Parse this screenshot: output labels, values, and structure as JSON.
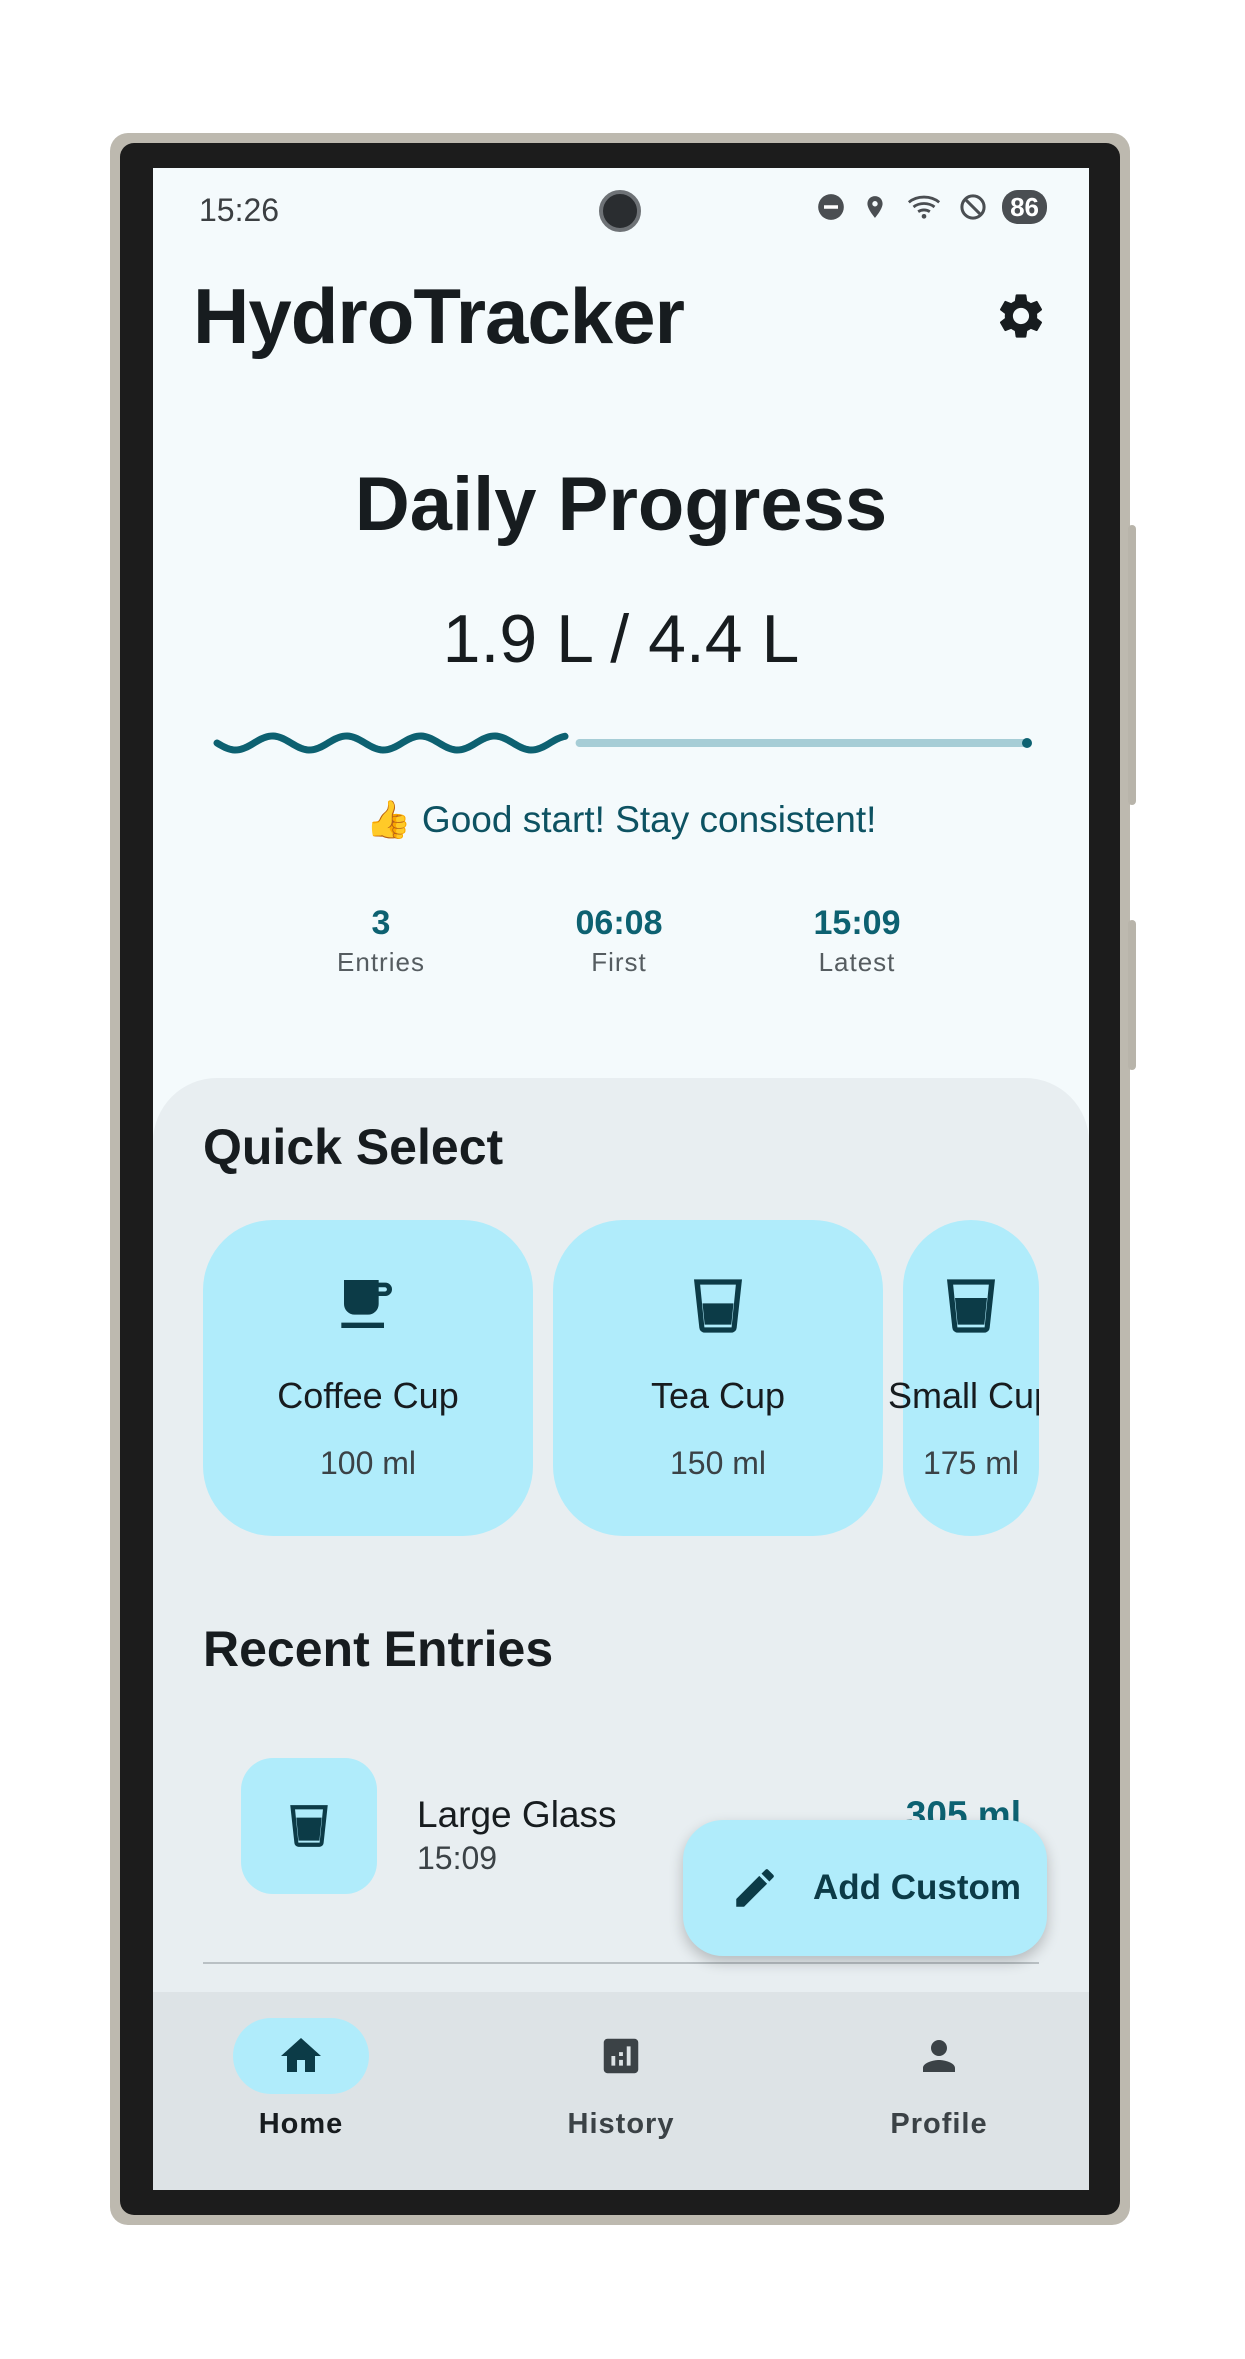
{
  "status_bar": {
    "time": "15:26",
    "battery": "86",
    "icons": [
      "do-not-disturb-icon",
      "location-icon",
      "wifi-icon",
      "blocked-icon"
    ]
  },
  "app_bar": {
    "title": "HydroTracker",
    "settings_icon": "gear-icon"
  },
  "progress": {
    "title": "Daily Progress",
    "amount_text": "1.9 L / 4.4 L",
    "fraction": 0.43,
    "message": "👍 Good start! Stay consistent!",
    "stats": [
      {
        "value": "3",
        "label": "Entries"
      },
      {
        "value": "06:08",
        "label": "First"
      },
      {
        "value": "15:09",
        "label": "Latest"
      }
    ]
  },
  "quick_select": {
    "title": "Quick Select",
    "items": [
      {
        "name": "Coffee Cup",
        "volume": "100 ml",
        "icon": "coffee-cup-icon"
      },
      {
        "name": "Tea Cup",
        "volume": "150 ml",
        "icon": "glass-icon"
      },
      {
        "name": "Small Cup",
        "volume": "175 ml",
        "icon": "glass-icon"
      }
    ]
  },
  "recent_entries": {
    "title": "Recent Entries",
    "items": [
      {
        "name": "Large Glass",
        "time": "15:09",
        "amount": "305 ml",
        "icon": "glass-icon"
      }
    ]
  },
  "fab": {
    "label": "Add Custom",
    "icon": "pencil-icon"
  },
  "bottom_nav": {
    "items": [
      {
        "label": "Home",
        "icon": "home-icon",
        "active": true
      },
      {
        "label": "History",
        "icon": "chart-icon",
        "active": false
      },
      {
        "label": "Profile",
        "icon": "person-icon",
        "active": false
      }
    ]
  },
  "colors": {
    "accent": "#0d6171",
    "card_bg": "#b0ecfb",
    "screen_bg": "#f4fafc",
    "sheet_bg": "#e8eef1",
    "nav_bg": "#dde3e6"
  }
}
